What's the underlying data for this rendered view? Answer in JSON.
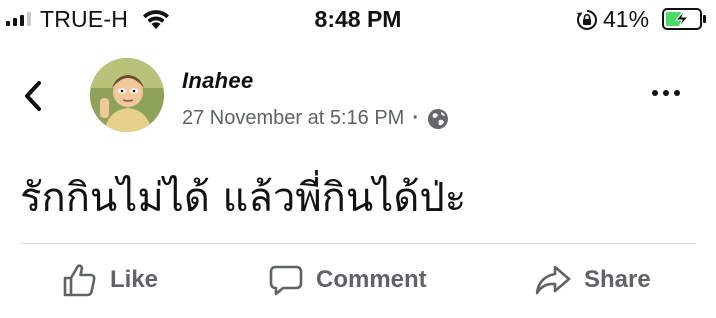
{
  "status_bar": {
    "carrier": "TRUE-H",
    "time": "8:48 PM",
    "battery_percent": "41%",
    "signal_bars_active": 3,
    "signal_bars_total": 4
  },
  "post": {
    "author": "Inahee",
    "timestamp": "27 November at 5:16 PM",
    "separator": "·",
    "audience_icon": "globe-icon",
    "text": "รักกินไม่ได้ แล้วพี่กินได้ป่ะ"
  },
  "actions": [
    {
      "label": "Like",
      "icon": "thumbs-up-icon"
    },
    {
      "label": "Comment",
      "icon": "comment-bubble-icon"
    },
    {
      "label": "Share",
      "icon": "share-arrow-icon"
    }
  ],
  "colors": {
    "text": "#111111",
    "secondary": "#5f6368",
    "battery_fill": "#4cd964",
    "divider": "#dcdcdc"
  }
}
